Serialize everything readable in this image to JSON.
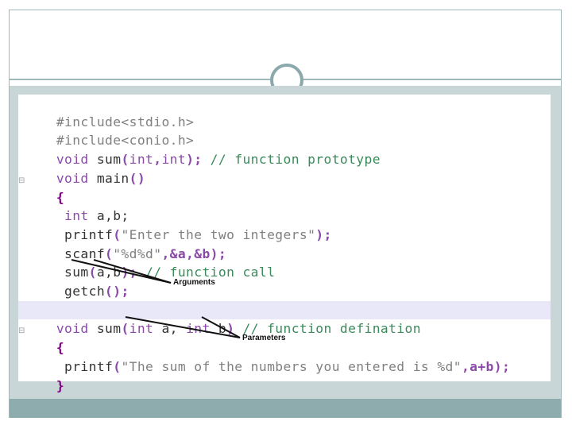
{
  "code": {
    "lines": [
      {
        "a": "#include<stdio.h>"
      },
      {
        "a": "#include<conio.h>"
      },
      {
        "kw1": "void",
        "sp1": " sum",
        "p1": "(",
        "kw2": "int",
        "c1": ",",
        "kw3": "int",
        "p2": ")",
        "semi": ";",
        "cmt": " // function prototype"
      },
      {
        "kw1": "void",
        "sp1": " main",
        "p1": "()"
      },
      {
        "brace": "{"
      },
      {
        "kw1": " int",
        "rest": " a,b;"
      },
      {
        "fn": " printf",
        "p1": "(",
        "str": "\"Enter the two integers\"",
        "p2": ")",
        "semi": ";"
      },
      {
        "fn": " scanf",
        "p1": "(",
        "str": "\"%d%d\"",
        "rest": ",&a,&b",
        "p2": ")",
        "semi": ";"
      },
      {
        "fn": " sum",
        "p1": "(",
        "rest": "a,b",
        "p2": ")",
        "semi": ";",
        "cmt": " // function call"
      },
      {
        "fn": " getch",
        "p1": "()",
        "semi": ";"
      },
      {
        "brace": "}"
      },
      {
        "kw1": "void",
        "sp1": " sum",
        "p1": "(",
        "kw2": "int",
        "rest1": " a, ",
        "kw3": "int",
        "rest2": " b",
        "p2": ")",
        "cmt": " // function defination"
      },
      {
        "brace": "{"
      },
      {
        "fn": " printf",
        "p1": "(",
        "str": "\"The sum of the numbers you entered is %d\"",
        "rest": ",a+b",
        "p2": ")",
        "semi": ";"
      },
      {
        "brace": "}"
      }
    ]
  },
  "annotations": {
    "arguments_label": "Arguments",
    "parameters_label": "Parameters"
  },
  "colors": {
    "frame": "#9fb8bb",
    "panel": "#c9d6d8",
    "bottom_bar": "#8eacae",
    "keyword": "#8a4aa8",
    "comment": "#3a8a5a",
    "highlight_line": "#e8e8f8"
  }
}
